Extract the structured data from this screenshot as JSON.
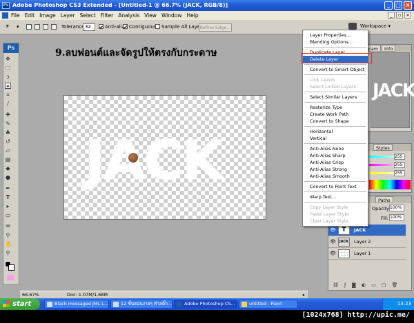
{
  "window": {
    "title": "Adobe Photoshop CS3 Extended - [Untitled-1 @ 66.7% (JACK, RGB/8)]"
  },
  "menubar": [
    "File",
    "Edit",
    "Image",
    "Layer",
    "Select",
    "Filter",
    "Analysis",
    "View",
    "Window",
    "Help"
  ],
  "options": {
    "tolerance_label": "Tolerance:",
    "tolerance_value": "32",
    "antialias": "Anti-alias",
    "contiguous": "Contiguous",
    "sample_all": "Sample All Layers",
    "refine": "Refine Edge...",
    "workspace": "Workspace ▾"
  },
  "instruction": "9.ลบฟอนต์และจัดรูปให้ตรงกับกระดาษ",
  "canvas": {
    "text": "JACK"
  },
  "status": {
    "zoom": "66.67%",
    "doc": "Doc: 1.07M/1.68M"
  },
  "panels": {
    "tabs_top": [
      "gram",
      "Info"
    ],
    "tabs_mid": [
      "Styles"
    ],
    "tabs_layers": [
      "Paths"
    ],
    "opacity_label": "Opacity:",
    "opacity_value": "100%",
    "fill_label": "Fill:",
    "fill_value": "100%",
    "color_values": [
      "255",
      "255",
      "255"
    ]
  },
  "layers": [
    {
      "name": "JACK",
      "selected": true,
      "thumb": "T"
    },
    {
      "name": "Layer 2",
      "selected": false,
      "thumb": "JACK"
    },
    {
      "name": "Layer 1",
      "selected": false,
      "thumb": ""
    }
  ],
  "context_menu": [
    {
      "label": "Layer Properties...",
      "state": "normal"
    },
    {
      "label": "Blending Options...",
      "state": "normal"
    },
    {
      "sep": true
    },
    {
      "label": "Duplicate Layer...",
      "state": "normal"
    },
    {
      "label": "Delete Layer",
      "state": "highlighted"
    },
    {
      "sep": true
    },
    {
      "label": "Convert to Smart Object",
      "state": "normal"
    },
    {
      "sep": true
    },
    {
      "label": "Link Layers",
      "state": "disabled"
    },
    {
      "label": "Select Linked Layers",
      "state": "disabled"
    },
    {
      "sep": true
    },
    {
      "label": "Select Similar Layers",
      "state": "normal"
    },
    {
      "sep": true
    },
    {
      "label": "Rasterize Type",
      "state": "normal"
    },
    {
      "label": "Create Work Path",
      "state": "normal"
    },
    {
      "label": "Convert to Shape",
      "state": "normal"
    },
    {
      "sep": true
    },
    {
      "label": "Horizontal",
      "state": "normal"
    },
    {
      "label": "Vertical",
      "state": "normal"
    },
    {
      "sep": true
    },
    {
      "label": "Anti-Alias None",
      "state": "normal"
    },
    {
      "label": "Anti-Alias Sharp",
      "state": "normal"
    },
    {
      "label": "Anti-Alias Crisp",
      "state": "normal"
    },
    {
      "label": "Anti-Alias Strong",
      "state": "normal"
    },
    {
      "label": "Anti-Alias Smooth",
      "state": "normal"
    },
    {
      "sep": true
    },
    {
      "label": "Convert to Point Text",
      "state": "normal"
    },
    {
      "sep": true
    },
    {
      "label": "Warp Text...",
      "state": "normal"
    },
    {
      "sep": true
    },
    {
      "label": "Copy Layer Style",
      "state": "disabled"
    },
    {
      "label": "Paste Layer Style",
      "state": "disabled"
    },
    {
      "label": "Clear Layer Style",
      "state": "disabled"
    }
  ],
  "taskbar": {
    "start": "start",
    "tasks": [
      {
        "label": "Black messaged JML L...",
        "active": false
      },
      {
        "label": "12 ขั้นตอนง่ายๆ ทำสติ๊ก...",
        "active": false
      },
      {
        "label": "Adobe Photoshop CS...",
        "active": true
      },
      {
        "label": "untitled - Paint",
        "active": false
      }
    ],
    "clock": "13:23"
  },
  "watermark": "[1024x768] http://upic.me/"
}
